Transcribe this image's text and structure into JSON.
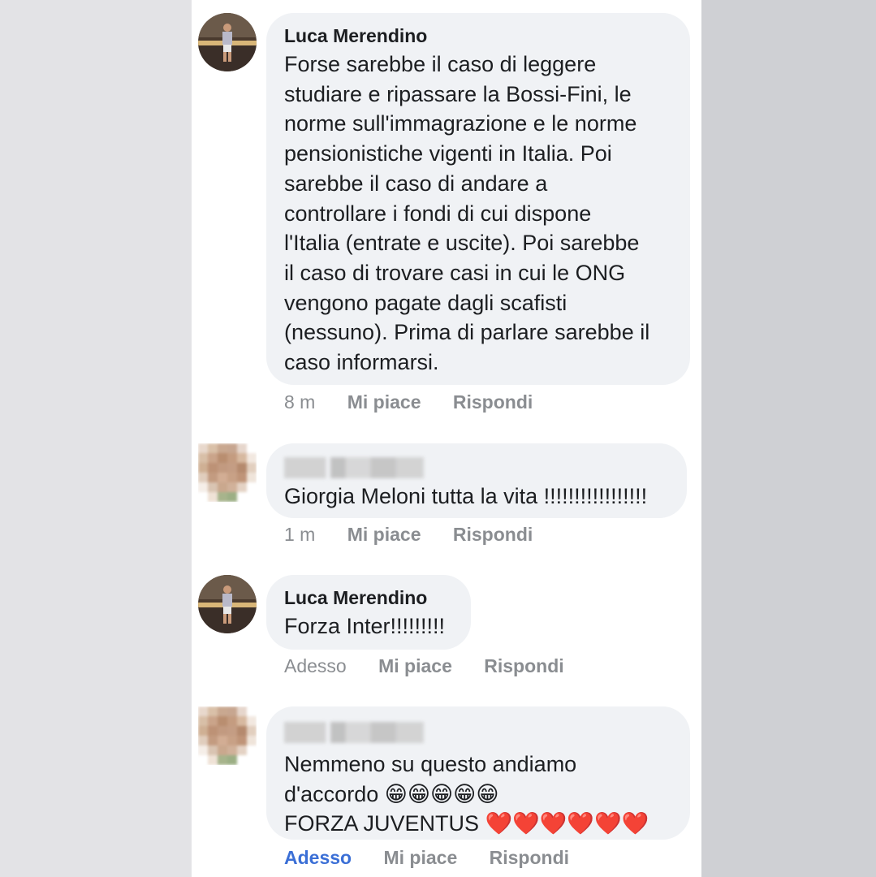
{
  "comments": [
    {
      "author": "Luca Merendino",
      "text": "Forse sarebbe il caso di leggere\nstudiare e ripassare la Bossi-Fini, le\nnorme sull'immagrazione e le norme\npensionistiche vigenti in Italia. Poi\nsarebbe il caso di andare a\ncontrollare i fondi di cui dispone\nl'Italia (entrate e uscite). Poi sarebbe\nil caso di trovare casi in cui le ONG\nvengono pagate dagli scafisti\n(nessuno). Prima di parlare sarebbe il\ncaso informarsi.",
      "time": "8 m",
      "like": "Mi piace",
      "reply": "Rispondi"
    },
    {
      "author": "",
      "text": "Giorgia Meloni tutta la vita !!!!!!!!!!!!!!!!!",
      "time": "1 m",
      "like": "Mi piace",
      "reply": "Rispondi"
    },
    {
      "author": "Luca Merendino",
      "text": "Forza Inter!!!!!!!!!",
      "time": "Adesso",
      "like": "Mi piace",
      "reply": "Rispondi"
    },
    {
      "author": "",
      "text": "Nemmeno su questo andiamo\nd'accordo 😁😁😁😁😁\nFORZA JUVENTUS ❤️❤️❤️❤️❤️❤️",
      "time": "Adesso",
      "like": "Mi piace",
      "reply": "Rispondi"
    }
  ],
  "colors": {
    "bubble": "#f0f2f5",
    "meta": "#8a8d91",
    "link_blue": "#3b6fd6"
  }
}
